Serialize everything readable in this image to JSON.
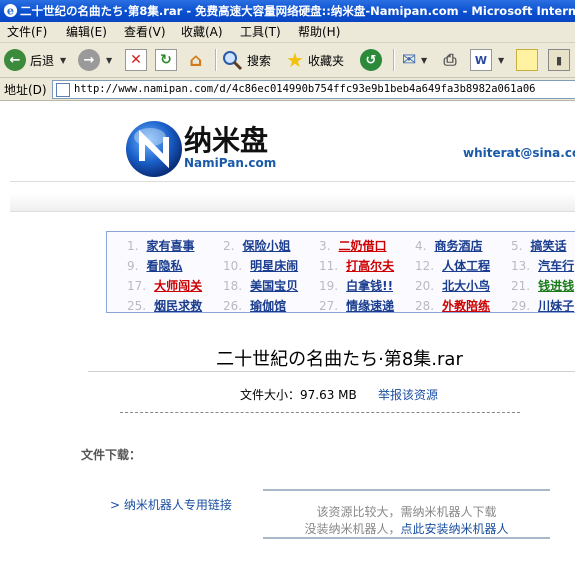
{
  "window": {
    "title": "二十世纪の名曲たち·第8集.rar - 免费高速大容量网络硬盘::纳米盘-Namipan.com - Microsoft Internet Explorer"
  },
  "menu": [
    "文件(F)",
    "编辑(E)",
    "查看(V)",
    "收藏(A)",
    "工具(T)",
    "帮助(H)"
  ],
  "toolbar": {
    "back": "后退",
    "search": "搜索",
    "favorites": "收藏夹"
  },
  "address": {
    "label": "地址(D)",
    "url": "http://www.namipan.com/d/4c86ec014990b754ffc93e9b1beb4a649fa3b8982a061a06"
  },
  "site": {
    "brand_cn": "纳米盘",
    "brand_en": "NamiPan.com",
    "user_email": "whiterat@sina.com"
  },
  "links": [
    {
      "num": "1.",
      "text": "家有喜事",
      "color": "#1a3d8f"
    },
    {
      "num": "2.",
      "text": "保险小姐",
      "color": "#1a3d8f"
    },
    {
      "num": "3.",
      "text": "二奶借口",
      "color": "#cc0000"
    },
    {
      "num": "4.",
      "text": "商务酒店",
      "color": "#1a3d8f"
    },
    {
      "num": "5.",
      "text": "搞笑话",
      "color": "#1a3d8f"
    },
    {
      "num": "9.",
      "text": "看隐私",
      "color": "#1a3d8f"
    },
    {
      "num": "10.",
      "text": "明星床闹",
      "color": "#1a3d8f"
    },
    {
      "num": "11.",
      "text": "打高尔夫",
      "color": "#cc0000"
    },
    {
      "num": "12.",
      "text": "人体工程",
      "color": "#1a3d8f"
    },
    {
      "num": "13.",
      "text": "汽车行",
      "color": "#1a3d8f"
    },
    {
      "num": "17.",
      "text": "大师闯关",
      "color": "#cc0000"
    },
    {
      "num": "18.",
      "text": "美国宝贝",
      "color": "#1a3d8f"
    },
    {
      "num": "19.",
      "text": "白拿钱!!",
      "color": "#1a3d8f"
    },
    {
      "num": "20.",
      "text": "北大小鸟",
      "color": "#1a3d8f"
    },
    {
      "num": "21.",
      "text": "钱进钱",
      "color": "#1a7a1a"
    },
    {
      "num": "25.",
      "text": "烟民求救",
      "color": "#1a3d8f"
    },
    {
      "num": "26.",
      "text": "瑜伽馆",
      "color": "#1a3d8f"
    },
    {
      "num": "27.",
      "text": "情缘速递",
      "color": "#1a3d8f"
    },
    {
      "num": "28.",
      "text": "外教陪练",
      "color": "#cc0000"
    },
    {
      "num": "29.",
      "text": "川妹子",
      "color": "#1a3d8f"
    }
  ],
  "file": {
    "title": "二十世紀の名曲たち·第8集.rar",
    "size_text": "文件大小：97.63 MB",
    "report_text": "举报该资源",
    "download_label": "文件下载：",
    "robot_link": "> 纳米机器人专用链接",
    "notice_line1": "该资源比较大，需纳米机器人下载",
    "notice_line2_prefix": "没装纳米机器人，",
    "notice_line2_link": "点此安装纳米机器人"
  }
}
